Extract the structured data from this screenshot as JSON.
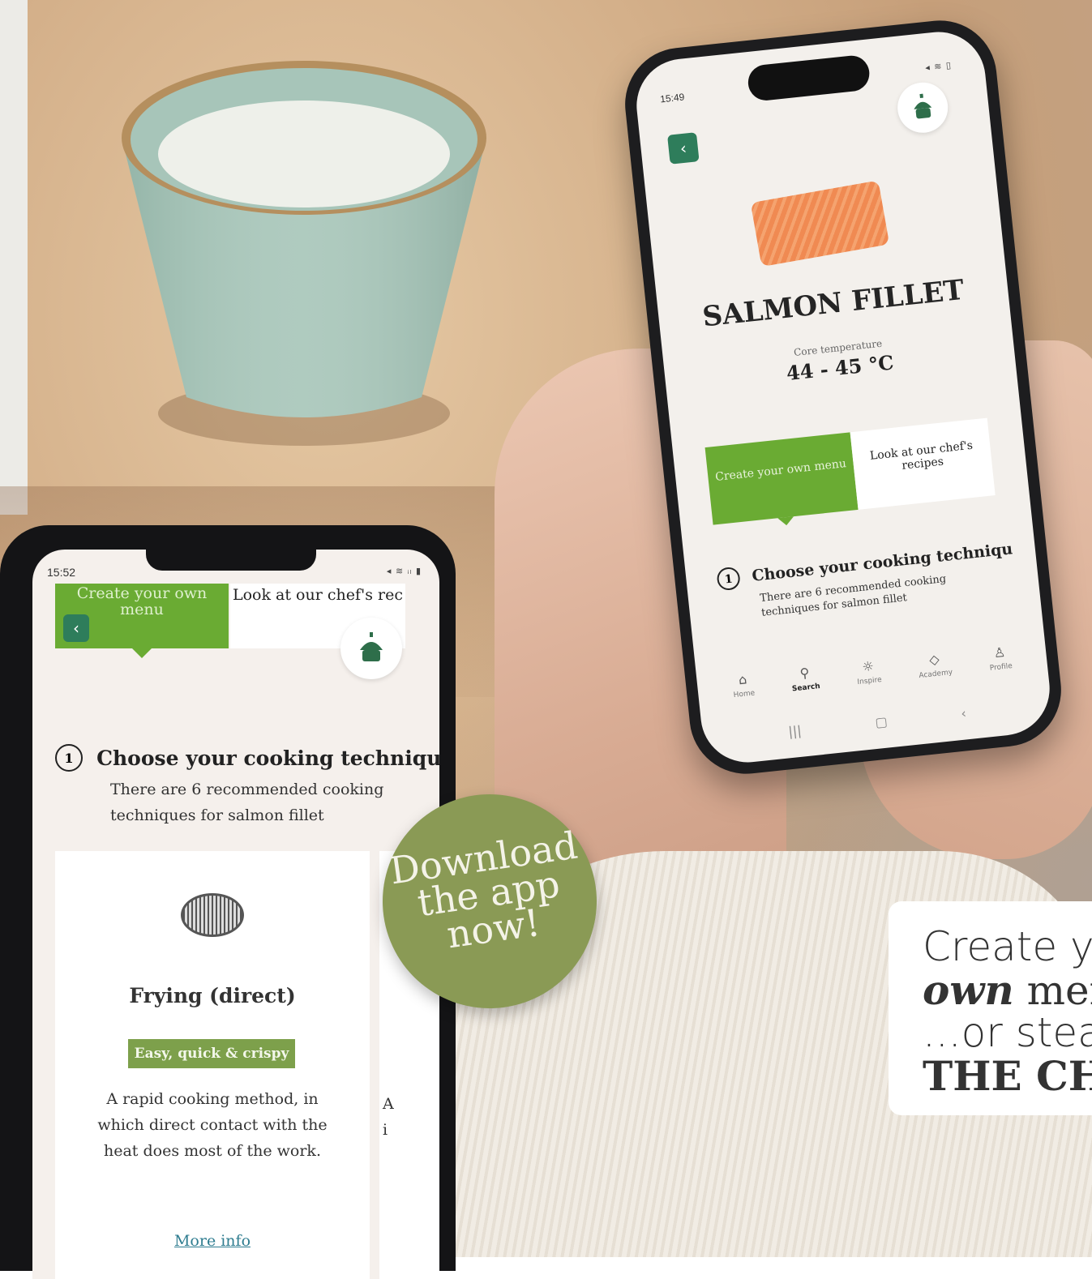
{
  "right_phone": {
    "time": "15:49",
    "status_icons": "◂ ≋ ▯",
    "back_label": "‹",
    "title": "SALMON FILLET",
    "core_label": "Core temperature",
    "core_value": "44 - 45 °C",
    "tab_create": "Create your own menu",
    "tab_recipes": "Look at our chef's recipes",
    "step_number": "1",
    "step_title": "Choose your cooking techniqu",
    "step_desc": "There are 6 recommended cooking techniques for salmon fillet",
    "nav": [
      {
        "label": "Home",
        "icon": "home-icon"
      },
      {
        "label": "Search",
        "icon": "search-icon"
      },
      {
        "label": "Inspire",
        "icon": "lightbulb-icon"
      },
      {
        "label": "Academy",
        "icon": "graduation-cap-icon"
      },
      {
        "label": "Profile",
        "icon": "user-icon"
      }
    ],
    "system_nav": [
      "|||",
      "▢",
      "‹"
    ]
  },
  "left_phone": {
    "time": "15:52",
    "status_icons": "◂ ≋ ᵢₗ ▮",
    "back_label": "‹",
    "tab_create": "Create your own menu",
    "tab_recipes": "Look at our chef's rec",
    "step_number": "1",
    "step_title": "Choose your cooking techniqu",
    "step_desc": "There are 6 recommended cooking techniques for salmon fillet",
    "card": {
      "title": "Frying (direct)",
      "badge": "Easy, quick & crispy",
      "description": "A rapid cooking method, in which direct contact with the heat does most of the work.",
      "link": "More info"
    },
    "card2_fragment": "A\ni"
  },
  "download_badge": {
    "line1": "Download",
    "line2": "the app",
    "line3": "now!",
    "color": "#8a9a55"
  },
  "tagline": {
    "line1": "Create y",
    "line2_bold": "own",
    "line2_rest": " mer",
    "line3": "...or steal",
    "line4": "THE CH"
  }
}
